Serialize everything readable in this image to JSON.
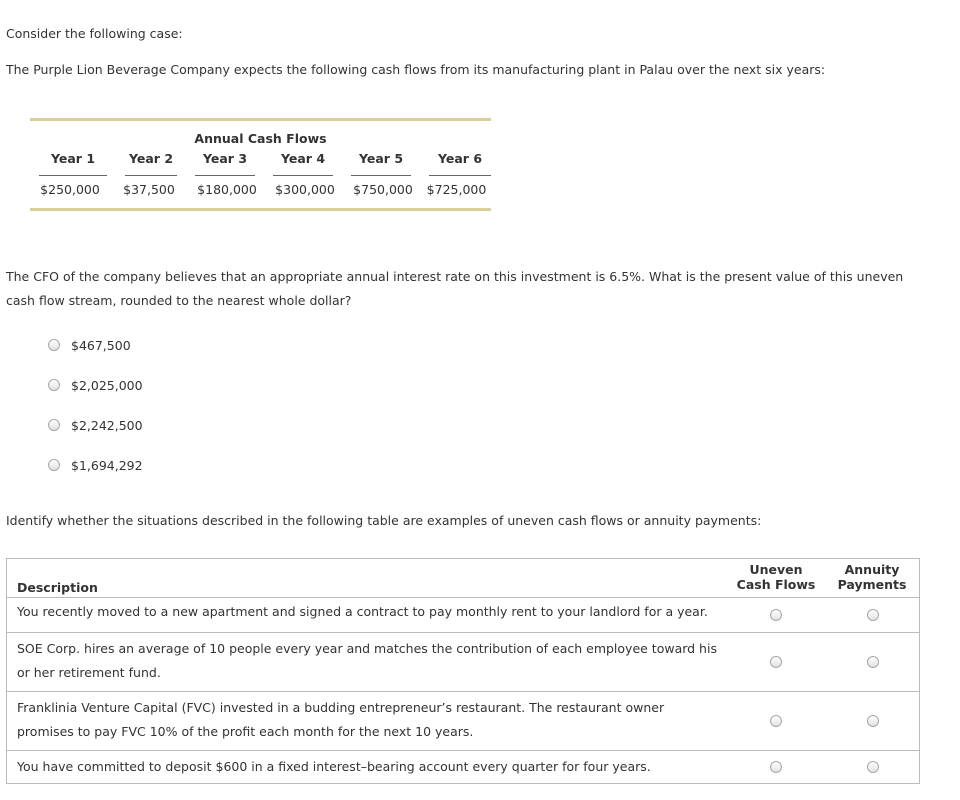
{
  "intro": "Consider the following case:",
  "case_text": "The Purple Lion Beverage Company expects the following cash flows from its manufacturing plant in Palau over the next six years:",
  "cash_flow_table": {
    "title": "Annual Cash Flows",
    "years": [
      "Year 1",
      "Year 2",
      "Year 3",
      "Year 4",
      "Year 5",
      "Year 6"
    ],
    "values": [
      "$250,000",
      "$37,500",
      "$180,000",
      "$300,000",
      "$750,000",
      "$725,000"
    ]
  },
  "question": "The CFO of the company believes that an appropriate annual interest rate on this investment is 6.5%. What is the present value of this uneven cash flow stream, rounded to the nearest whole dollar?",
  "options": [
    "$467,500",
    "$2,025,000",
    "$2,242,500",
    "$1,694,292"
  ],
  "identify": "Identify whether the situations described in the following table are examples of uneven cash flows or annuity payments:",
  "classify_table": {
    "description_header": "Description",
    "col_uneven_line1": "Uneven",
    "col_uneven_line2": "Cash Flows",
    "col_annuity_line1": "Annuity",
    "col_annuity_line2": "Payments",
    "rows": [
      "You recently moved to a new apartment and signed a contract to pay monthly rent to your landlord for a year.",
      "SOE Corp. hires an average of 10 people every year and matches the contribution of each employee toward his or her retirement fund.",
      "Franklinia Venture Capital (FVC) invested in a budding entrepreneur’s restaurant. The restaurant owner promises to pay FVC 10% of the profit each month for the next 10 years.",
      "You have committed to deposit $600 in a fixed interest–bearing account every quarter for four years."
    ]
  }
}
